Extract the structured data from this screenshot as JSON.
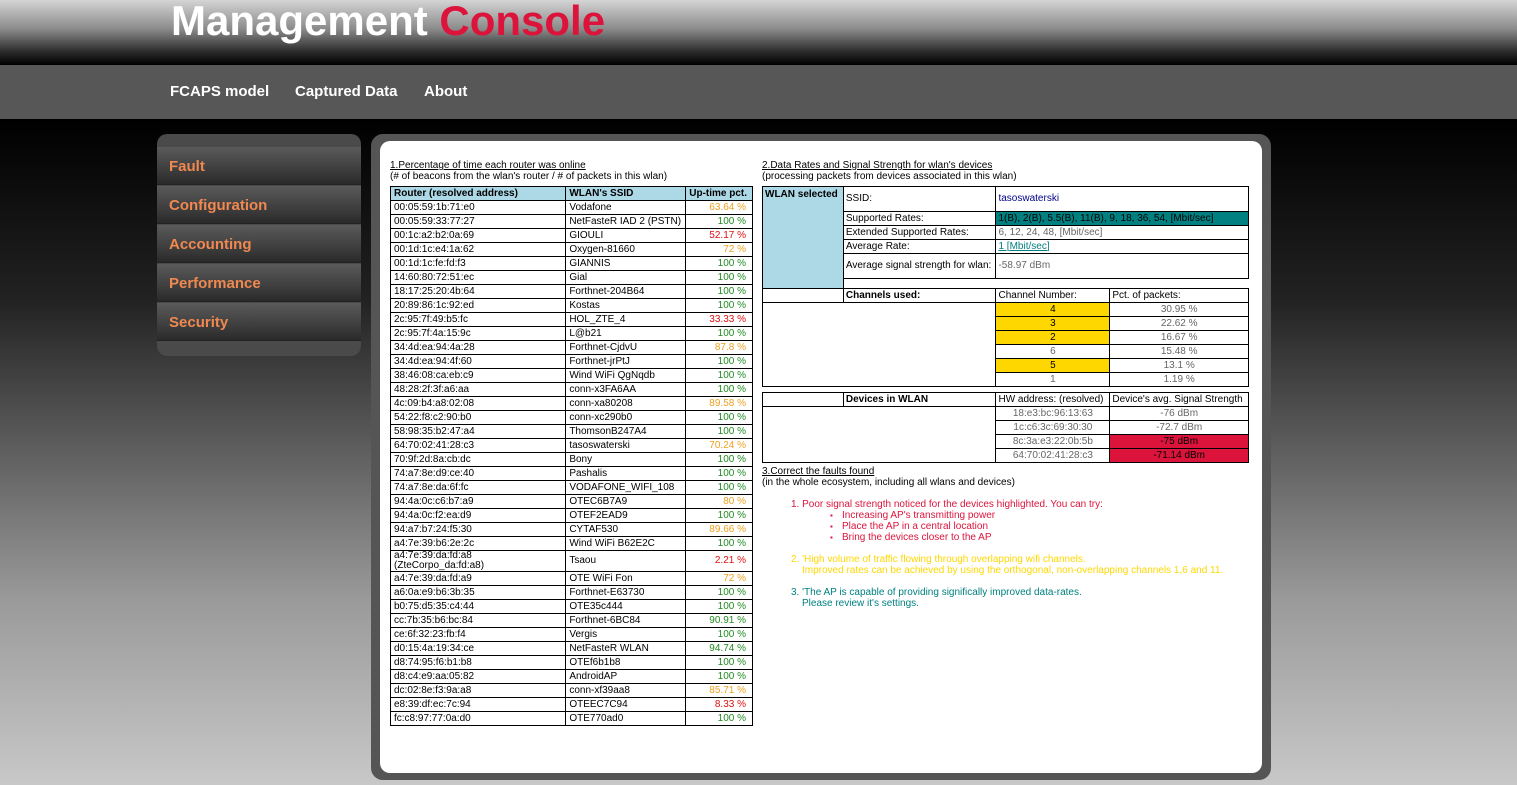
{
  "header": {
    "title_main": "Management",
    "title_accent": "Console"
  },
  "nav": {
    "items": [
      "FCAPS model",
      "Captured Data",
      "About"
    ]
  },
  "sidebar": {
    "items": [
      "Fault",
      "Configuration",
      "Accounting",
      "Performance",
      "Security"
    ]
  },
  "section1": {
    "title": "1.Percentage of time each router was online",
    "subtitle": "(# of beacons from the wlan's router / # of packets in this wlan)",
    "headers": [
      "Router (resolved address)",
      "WLAN's SSID",
      "Up-time pct."
    ],
    "rows": [
      {
        "router": "00:05:59:1b:71:e0",
        "ssid": "Vodafone",
        "pct": "63.64 %",
        "level": "o"
      },
      {
        "router": "00:05:59:33:77:27",
        "ssid": "NetFasteR IAD 2 (PSTN)",
        "pct": "100 %",
        "level": "g"
      },
      {
        "router": "00:1c:a2:b2:0a:69",
        "ssid": "GIOULI",
        "pct": "52.17 %",
        "level": "r"
      },
      {
        "router": "00:1d:1c:e4:1a:62",
        "ssid": "Oxygen-81660",
        "pct": "72 %",
        "level": "o"
      },
      {
        "router": "00:1d:1c:fe:fd:f3",
        "ssid": "GIANNIS",
        "pct": "100 %",
        "level": "g"
      },
      {
        "router": "14:60:80:72:51:ec",
        "ssid": "Gial",
        "pct": "100 %",
        "level": "g"
      },
      {
        "router": "18:17:25:20:4b:64",
        "ssid": "Forthnet-204B64",
        "pct": "100 %",
        "level": "g"
      },
      {
        "router": "20:89:86:1c:92:ed",
        "ssid": "Kostas",
        "pct": "100 %",
        "level": "g"
      },
      {
        "router": "2c:95:7f:49:b5:fc",
        "ssid": "HOL_ZTE_4",
        "pct": "33.33 %",
        "level": "r"
      },
      {
        "router": "2c:95:7f:4a:15:9c",
        "ssid": "L@b21",
        "pct": "100 %",
        "level": "g"
      },
      {
        "router": "34:4d:ea:94:4a:28",
        "ssid": "Forthnet-CjdvU",
        "pct": "87.8 %",
        "level": "o"
      },
      {
        "router": "34:4d:ea:94:4f:60",
        "ssid": "Forthnet-jrPtJ",
        "pct": "100 %",
        "level": "g"
      },
      {
        "router": "38:46:08:ca:eb:c9",
        "ssid": "Wind WiFi QgNqdb",
        "pct": "100 %",
        "level": "g"
      },
      {
        "router": "48:28:2f:3f:a6:aa",
        "ssid": "conn-x3FA6AA",
        "pct": "100 %",
        "level": "g"
      },
      {
        "router": "4c:09:b4:a8:02:08",
        "ssid": "conn-xa80208",
        "pct": "89.58 %",
        "level": "o"
      },
      {
        "router": "54:22:f8:c2:90:b0",
        "ssid": "conn-xc290b0",
        "pct": "100 %",
        "level": "g"
      },
      {
        "router": "58:98:35:b2:47:a4",
        "ssid": "ThomsonB247A4",
        "pct": "100 %",
        "level": "g"
      },
      {
        "router": "64:70:02:41:28:c3",
        "ssid": "tasoswaterski",
        "pct": "70.24 %",
        "level": "o"
      },
      {
        "router": "70:9f:2d:8a:cb:dc",
        "ssid": "Bony",
        "pct": "100 %",
        "level": "g"
      },
      {
        "router": "74:a7:8e:d9:ce:40",
        "ssid": "Pashalis",
        "pct": "100 %",
        "level": "g"
      },
      {
        "router": "74:a7:8e:da:6f:fc",
        "ssid": "VODAFONE_WIFI_108",
        "pct": "100 %",
        "level": "g"
      },
      {
        "router": "94:4a:0c:c6:b7:a9",
        "ssid": "OTEC6B7A9",
        "pct": "80 %",
        "level": "o"
      },
      {
        "router": "94:4a:0c:f2:ea:d9",
        "ssid": "OTEF2EAD9",
        "pct": "100 %",
        "level": "g"
      },
      {
        "router": "94:a7:b7:24:f5:30",
        "ssid": "CYTAF530",
        "pct": "89.66 %",
        "level": "o"
      },
      {
        "router": "a4:7e:39:b6:2e:2c",
        "ssid": "Wind WiFi B62E2C",
        "pct": "100 %",
        "level": "g"
      },
      {
        "router": "a4:7e:39:da:fd:a8 (ZteCorpo_da:fd:a8)",
        "ssid": "Tsaou",
        "pct": "2.21 %",
        "level": "r"
      },
      {
        "router": "a4:7e:39:da:fd:a9",
        "ssid": "OTE WiFi Fon",
        "pct": "72 %",
        "level": "o"
      },
      {
        "router": "a6:0a:e9:b6:3b:35",
        "ssid": "Forthnet-E63730",
        "pct": "100 %",
        "level": "g"
      },
      {
        "router": "b0:75:d5:35:c4:44",
        "ssid": "OTE35c444",
        "pct": "100 %",
        "level": "g"
      },
      {
        "router": "cc:7b:35:b6:bc:84",
        "ssid": "Forthnet-6BC84",
        "pct": "90.91 %",
        "level": "g"
      },
      {
        "router": "ce:6f:32:23:fb:f4",
        "ssid": "Vergis",
        "pct": "100 %",
        "level": "g"
      },
      {
        "router": "d0:15:4a:19:34:ce",
        "ssid": "NetFasteR WLAN",
        "pct": "94.74 %",
        "level": "g"
      },
      {
        "router": "d8:74:95:f6:b1:b8",
        "ssid": "OTEf6b1b8",
        "pct": "100 %",
        "level": "g"
      },
      {
        "router": "d8:c4:e9:aa:05:82",
        "ssid": "AndroidAP",
        "pct": "100 %",
        "level": "g"
      },
      {
        "router": "dc:02:8e:f3:9a:a8",
        "ssid": "conn-xf39aa8",
        "pct": "85.71 %",
        "level": "o"
      },
      {
        "router": "e8:39:df:ec:7c:94",
        "ssid": "OTEEC7C94",
        "pct": "8.33 %",
        "level": "r"
      },
      {
        "router": "fc:c8:97:77:0a:d0",
        "ssid": "OTE770ad0",
        "pct": "100 %",
        "level": "g"
      }
    ]
  },
  "section2": {
    "title": "2.Data Rates and Signal Strength for wlan's devices",
    "subtitle": "(processing packets from devices associated in this wlan)",
    "wlan_selected_label": "WLAN selected",
    "ssid_label": "SSID:",
    "ssid_value": "tasoswaterski",
    "supported_rates_label": "Supported Rates:",
    "supported_rates_value": "1(B), 2(B), 5.5(B), 11(B), 9, 18, 36, 54, [Mbit/sec]",
    "extended_rates_label": "Extended Supported Rates:",
    "extended_rates_value": "6, 12, 24, 48, [Mbit/sec]",
    "average_rate_label": "Average Rate:",
    "average_rate_value": "1 [Mbit/sec]",
    "avg_signal_label": "Average signal strength for wlan:",
    "avg_signal_value": "-58.97 dBm",
    "channels_label": "Channels used:",
    "channel_number_header": "Channel Number:",
    "channel_pct_header": "Pct. of packets:",
    "channels": [
      {
        "number": "4",
        "pct": "30.95 %",
        "highlight": true
      },
      {
        "number": "3",
        "pct": "22.62 %",
        "highlight": true
      },
      {
        "number": "2",
        "pct": "16.67 %",
        "highlight": true
      },
      {
        "number": "6",
        "pct": "15.48 %",
        "highlight": false
      },
      {
        "number": "5",
        "pct": "13.1 %",
        "highlight": true
      },
      {
        "number": "1",
        "pct": "1.19 %",
        "highlight": false
      }
    ],
    "devices_label": "Devices in WLAN",
    "hw_header": "HW address: (resolved)",
    "signal_header": "Device's avg. Signal Strength",
    "devices": [
      {
        "hw": "18:e3:bc:96:13:63",
        "signal": "-76 dBm",
        "weak": false
      },
      {
        "hw": "1c:c6:3c:69:30:30",
        "signal": "-72.7 dBm",
        "weak": false
      },
      {
        "hw": "8c:3a:e3:22:0b:5b",
        "signal": "-75 dBm",
        "weak": true
      },
      {
        "hw": "64:70:02:41:28:c3",
        "signal": "-71.14 dBm",
        "weak": true
      }
    ]
  },
  "section3": {
    "title": "3.Correct the faults found",
    "subtitle": "(in the whole ecosystem, including all wlans and devices)",
    "fault1": "1. Poor signal strength noticed for the devices highlighted. You can try:",
    "fault1_bullets": [
      "Increasing AP's transmitting power",
      "Place the AP in a central location",
      "Bring the devices closer to the AP"
    ],
    "fault2_line1": "2. 'High volume of traffic flowing through overlapping wifi channels.",
    "fault2_line2": "Improved rates can be achieved by using the orthogonal, non-overlapping channels 1,6 and 11.",
    "fault3_line1": "3. 'The AP is capable of providing significally improved data-rates.",
    "fault3_line2": "Please review it's settings."
  }
}
